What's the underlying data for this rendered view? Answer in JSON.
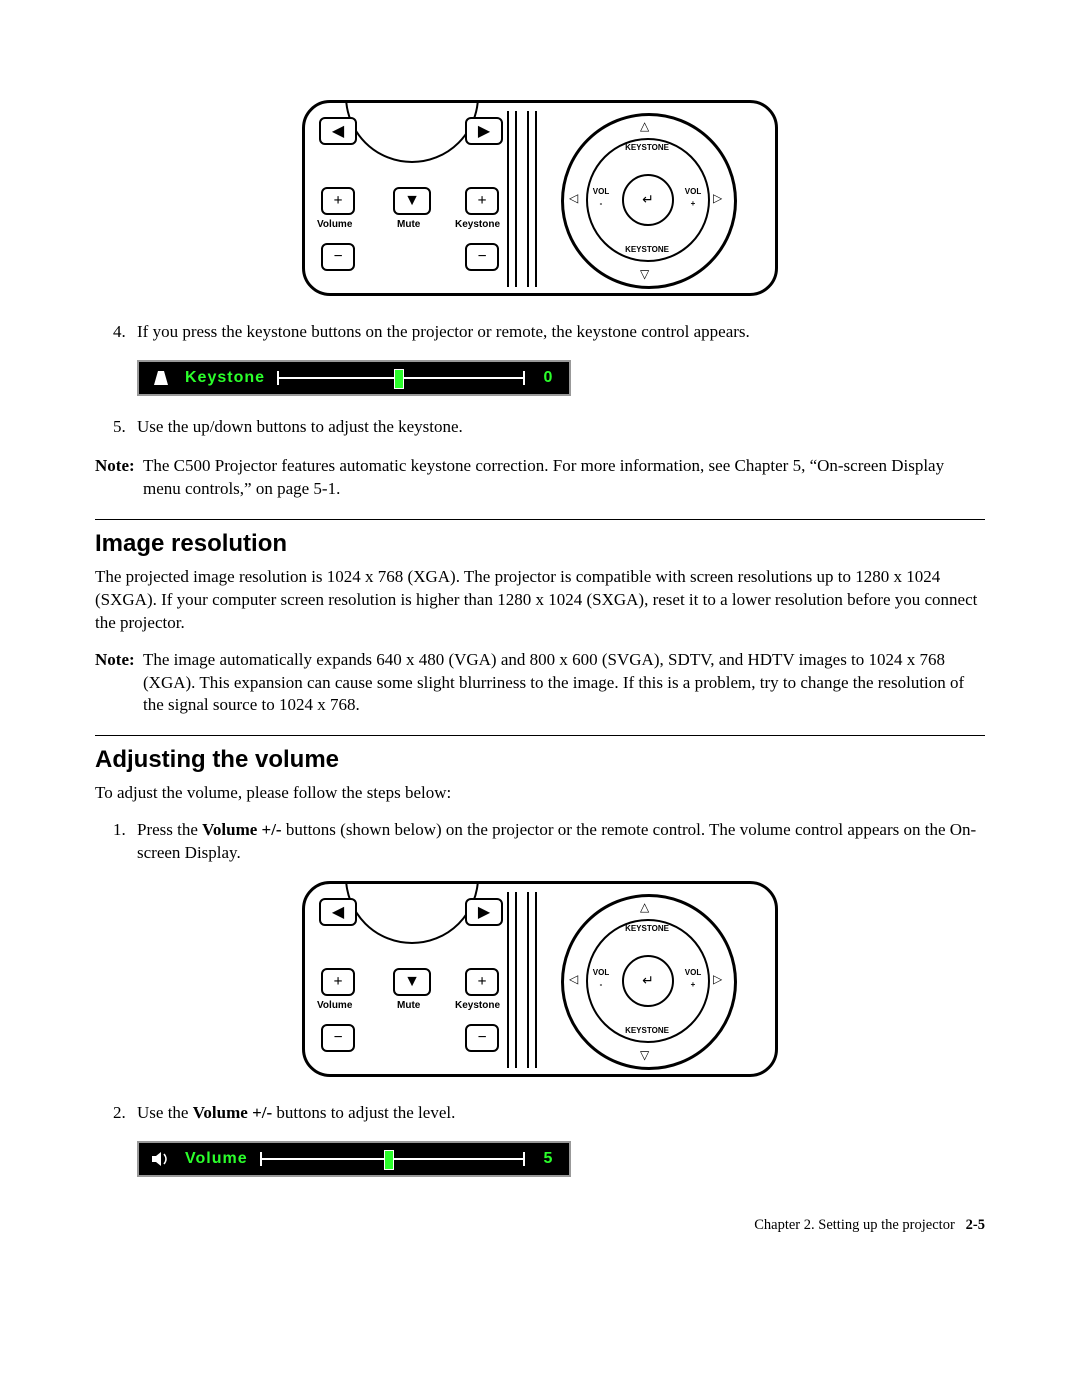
{
  "diagram": {
    "volume_label": "Volume",
    "mute_label": "Mute",
    "keystone_label": "Keystone",
    "dial_top": "KEYSTONE",
    "dial_bottom": "KEYSTONE",
    "dial_left_a": "VOL",
    "dial_left_b": "-",
    "dial_right_a": "VOL",
    "dial_right_b": "+"
  },
  "step4": {
    "num": "4.",
    "text": "If you press the keystone buttons on the projector or remote, the keystone control appears."
  },
  "osd_keystone": {
    "label": "Keystone",
    "value": "0"
  },
  "step5": {
    "num": "5.",
    "text": "Use the up/down buttons to adjust the keystone."
  },
  "note1": {
    "label": "Note:",
    "text": "The C500 Projector features automatic keystone correction. For more information, see Chapter 5, “On-screen Display menu controls,” on page 5-1."
  },
  "section1": {
    "heading": "Image resolution",
    "para": "The projected image resolution is 1024 x 768 (XGA). The projector is compatible with screen resolutions up to 1280 x 1024 (SXGA). If your computer screen resolution is higher than 1280 x 1024 (SXGA), reset it to a lower resolution before you connect the projector."
  },
  "note2": {
    "label": "Note:",
    "text": "The image automatically expands 640 x 480 (VGA) and 800 x 600 (SVGA), SDTV, and HDTV images to 1024 x 768 (XGA). This expansion can cause some slight blurriness to the image. If this is a problem, try to change the resolution of the signal source to 1024 x 768."
  },
  "section2": {
    "heading": "Adjusting the volume",
    "intro": "To adjust the volume, please follow the steps below:"
  },
  "vstep1": {
    "num": "1.",
    "pre": "Press the ",
    "bold": "Volume +/-",
    "post": " buttons (shown below) on the projector or the remote control. The volume control appears on the On-screen Display."
  },
  "vstep2": {
    "num": "2.",
    "pre": "Use the ",
    "bold": "Volume +/-",
    "post": " buttons to adjust the level."
  },
  "osd_volume": {
    "label": "Volume",
    "value": "5"
  },
  "footer": {
    "chapter": "Chapter 2. Setting up the projector",
    "page": "2-5"
  },
  "chart_data": {
    "type": "table",
    "title": "On-screen Display slider values",
    "series": [
      {
        "name": "Keystone",
        "values": [
          0
        ]
      },
      {
        "name": "Volume",
        "values": [
          5
        ]
      }
    ]
  }
}
